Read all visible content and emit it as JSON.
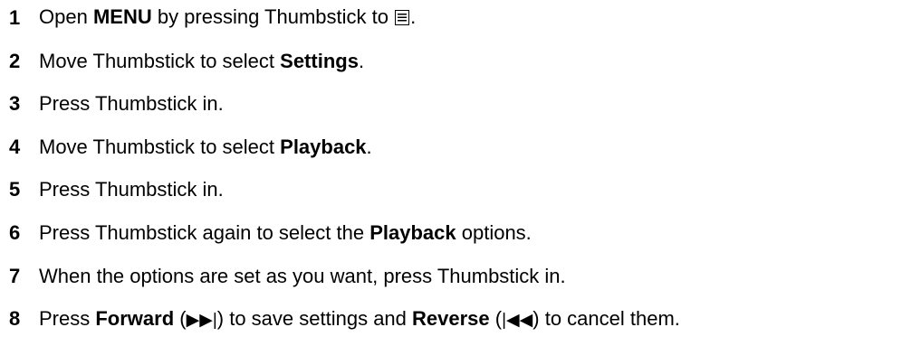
{
  "steps": [
    {
      "number": "1",
      "parts": {
        "t1": "Open ",
        "b1": "MENU",
        "t2": " by pressing Thumbstick to ",
        "icon": "menu-list-icon",
        "t3": "."
      }
    },
    {
      "number": "2",
      "parts": {
        "t1": "Move Thumbstick to select ",
        "b1": "Settings",
        "t2": "."
      }
    },
    {
      "number": "3",
      "parts": {
        "t1": "Press Thumbstick in."
      }
    },
    {
      "number": "4",
      "parts": {
        "t1": "Move Thumbstick to select ",
        "b1": "Playback",
        "t2": "."
      }
    },
    {
      "number": "5",
      "parts": {
        "t1": "Press Thumbstick in."
      }
    },
    {
      "number": "6",
      "parts": {
        "t1": "Press Thumbstick again to select the ",
        "b1": "Playback",
        "t2": " options."
      }
    },
    {
      "number": "7",
      "parts": {
        "t1": "When the options are set as you want, press Thumbstick in."
      }
    },
    {
      "number": "8",
      "parts": {
        "t1": "Press ",
        "b1": "Forward",
        "t2": " (",
        "g1": "▶▶|",
        "t3": ") to save settings and ",
        "b2": "Reverse",
        "t4": " (",
        "g2": "|◀◀",
        "t5": ") to cancel them."
      }
    }
  ]
}
